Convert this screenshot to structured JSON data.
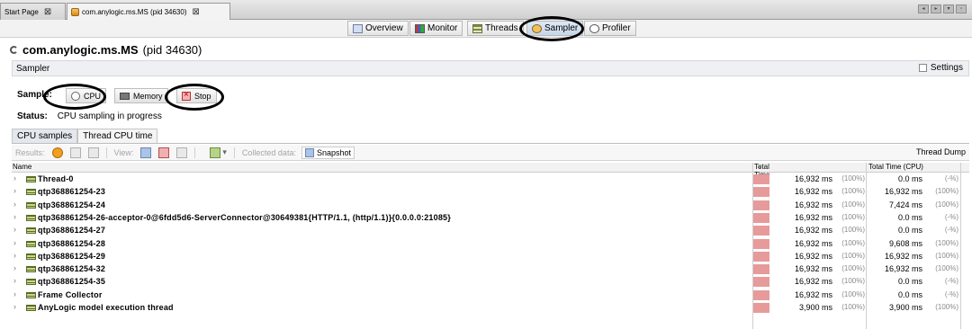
{
  "tabs": [
    {
      "label": "Start Page"
    },
    {
      "label": "com.anylogic.ms.MS (pid 34630)"
    }
  ],
  "views": {
    "overview": "Overview",
    "monitor": "Monitor",
    "threads": "Threads",
    "sampler": "Sampler",
    "profiler": "Profiler"
  },
  "process": {
    "name": "com.anylogic.ms.MS",
    "pid": "(pid 34630)"
  },
  "section": {
    "title": "Sampler",
    "settings": "Settings"
  },
  "sample": {
    "label": "Sample:",
    "cpu": "CPU",
    "memory": "Memory",
    "stop": "Stop"
  },
  "status": {
    "label": "Status:",
    "value": "CPU sampling in progress"
  },
  "result_tabs": [
    "CPU samples",
    "Thread CPU time"
  ],
  "toolbar": {
    "results": "Results:",
    "view": "View:",
    "collected": "Collected data:",
    "snapshot": "Snapshot",
    "thread_dump": "Thread Dump"
  },
  "columns": {
    "name": "Name",
    "total_time": "Total Time",
    "total_time_cpu": "Total Time (CPU)"
  },
  "rows": [
    {
      "name": "Thread-0",
      "time": "16,932 ms",
      "pct": "(100%)",
      "cpu": "0.0 ms",
      "cpu_pct": "(-%)"
    },
    {
      "name": "qtp368861254-23",
      "time": "16,932 ms",
      "pct": "(100%)",
      "cpu": "16,932 ms",
      "cpu_pct": "(100%)"
    },
    {
      "name": "qtp368861254-24",
      "time": "16,932 ms",
      "pct": "(100%)",
      "cpu": "7,424 ms",
      "cpu_pct": "(100%)"
    },
    {
      "name": "qtp368861254-26-acceptor-0@6fdd5d6-ServerConnector@30649381{HTTP/1.1, (http/1.1)}{0.0.0.0:21085}",
      "time": "16,932 ms",
      "pct": "(100%)",
      "cpu": "0.0 ms",
      "cpu_pct": "(-%)"
    },
    {
      "name": "qtp368861254-27",
      "time": "16,932 ms",
      "pct": "(100%)",
      "cpu": "0.0 ms",
      "cpu_pct": "(-%)"
    },
    {
      "name": "qtp368861254-28",
      "time": "16,932 ms",
      "pct": "(100%)",
      "cpu": "9,608 ms",
      "cpu_pct": "(100%)"
    },
    {
      "name": "qtp368861254-29",
      "time": "16,932 ms",
      "pct": "(100%)",
      "cpu": "16,932 ms",
      "cpu_pct": "(100%)"
    },
    {
      "name": "qtp368861254-32",
      "time": "16,932 ms",
      "pct": "(100%)",
      "cpu": "16,932 ms",
      "cpu_pct": "(100%)"
    },
    {
      "name": "qtp368861254-35",
      "time": "16,932 ms",
      "pct": "(100%)",
      "cpu": "0.0 ms",
      "cpu_pct": "(-%)"
    },
    {
      "name": "Frame Collector",
      "time": "16,932 ms",
      "pct": "(100%)",
      "cpu": "0.0 ms",
      "cpu_pct": "(-%)"
    },
    {
      "name": "AnyLogic model execution thread",
      "time": "3,900 ms",
      "pct": "(100%)",
      "cpu": "3,900 ms",
      "cpu_pct": "(100%)"
    }
  ]
}
